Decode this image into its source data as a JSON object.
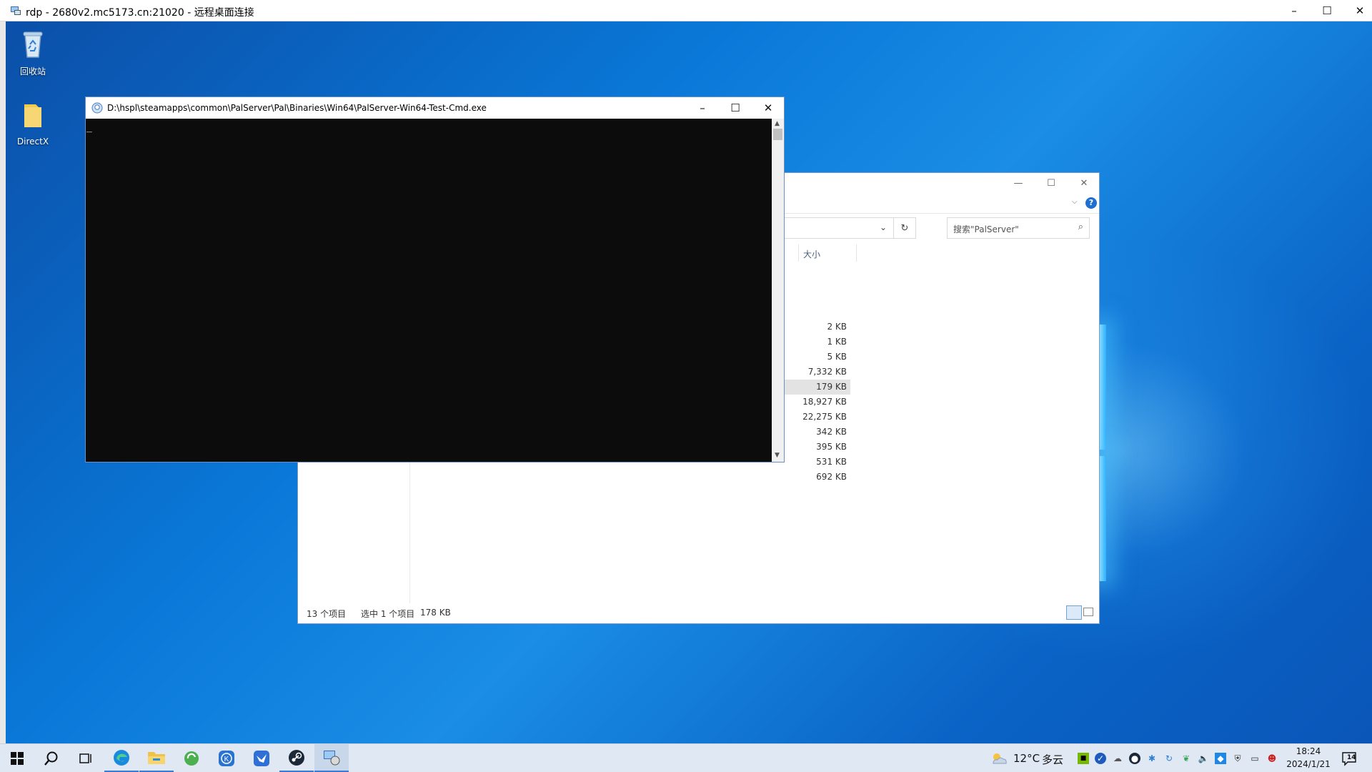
{
  "rdp": {
    "title": "rdp - 2680v2.mc5173.cn:21020 - 远程桌面连接",
    "minimize": "–",
    "maximize": "☐",
    "close": "✕"
  },
  "desktop": {
    "icons": [
      {
        "label": "回收站",
        "icon": "recycle-bin-icon"
      },
      {
        "label": "DirectX",
        "icon": "folder-icon"
      }
    ]
  },
  "cmd": {
    "title": "D:\\hspl\\steamapps\\common\\PalServer\\Pal\\Binaries\\Win64\\PalServer-Win64-Test-Cmd.exe",
    "cursor": "_"
  },
  "explorer": {
    "search_placeholder": "搜索\"PalServer\"",
    "column_size": "大小",
    "sizes": [
      "2 KB",
      "1 KB",
      "5 KB",
      "7,332 KB",
      "179 KB",
      "18,927 KB",
      "22,275 KB",
      "342 KB",
      "395 KB",
      "531 KB",
      "692 KB"
    ],
    "selected_index": 4,
    "status_count": "13 个项目",
    "status_selected": "选中 1 个项目",
    "status_size": "178 KB",
    "help": "?"
  },
  "taskbar": {
    "weather_temp": "12°C",
    "weather_desc": "多云",
    "time": "18:24",
    "date": "2024/1/21",
    "notification_count": "14"
  }
}
